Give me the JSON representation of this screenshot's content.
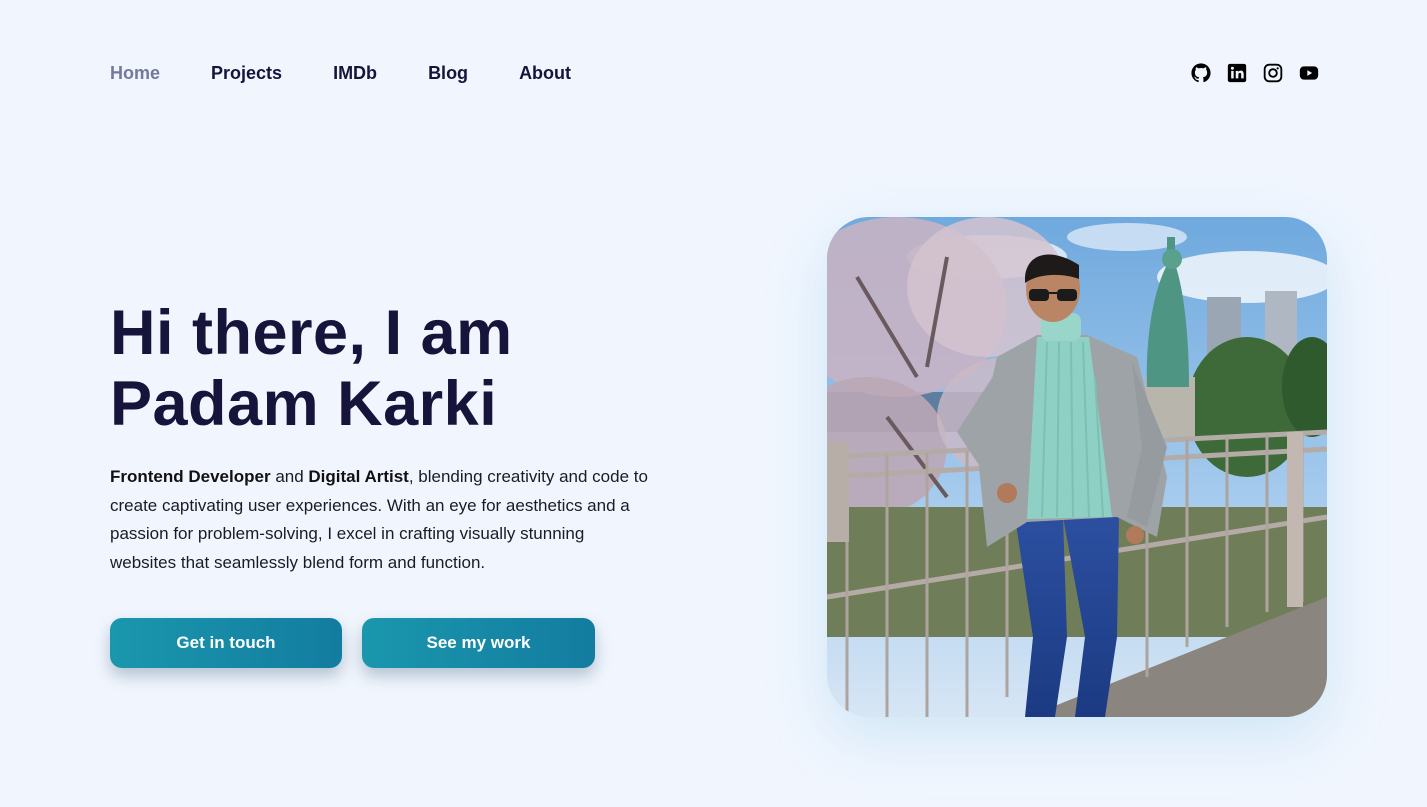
{
  "nav": {
    "items": [
      {
        "label": "Home",
        "active": true
      },
      {
        "label": "Projects",
        "active": false
      },
      {
        "label": "IMDb",
        "active": false
      },
      {
        "label": "Blog",
        "active": false
      },
      {
        "label": "About",
        "active": false
      }
    ]
  },
  "social": {
    "icons": [
      "github-icon",
      "linkedin-icon",
      "instagram-icon",
      "youtube-icon"
    ]
  },
  "hero": {
    "title_line1": "Hi there, I am",
    "title_line2": "Padam Karki",
    "bio": {
      "role1": "Frontend Developer",
      "join": " and ",
      "role2": "Digital Artist",
      "rest": ", blending creativity and code to create captivating user experiences. With an eye for aesthetics and a passion for problem-solving, I excel in crafting visually stunning websites that seamlessly blend form and function."
    },
    "buttons": {
      "contact": "Get in touch",
      "work": "See my work"
    }
  },
  "colors": {
    "background": "#f1f6fe",
    "text_dark": "#16143a",
    "nav_active": "#727a9c",
    "button_start": "#1a97ad",
    "button_end": "#137ca0"
  }
}
